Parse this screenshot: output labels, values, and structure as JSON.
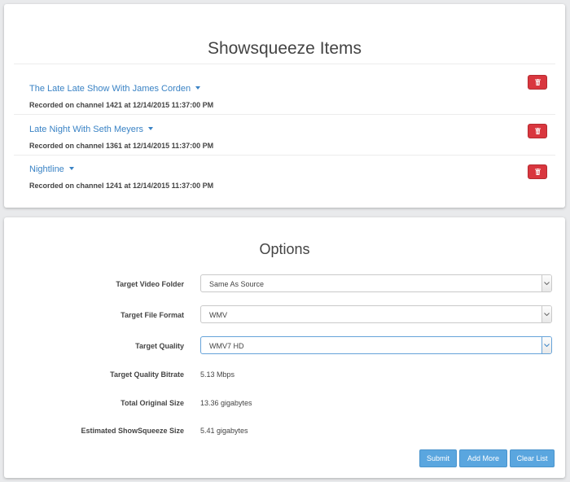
{
  "items_panel": {
    "title": "Showsqueeze Items",
    "items": [
      {
        "title": "The Late Late Show With James Corden",
        "detail": "Recorded on channel 1421 at 12/14/2015 11:37:00 PM"
      },
      {
        "title": "Late Night With Seth Meyers",
        "detail": "Recorded on channel 1361 at 12/14/2015 11:37:00 PM"
      },
      {
        "title": "Nightline",
        "detail": "Recorded on channel 1241 at 12/14/2015 11:37:00 PM"
      }
    ],
    "delete_icon": "trash-icon"
  },
  "options_panel": {
    "title": "Options",
    "target_video_folder": {
      "label": "Target Video Folder",
      "value": "Same As Source"
    },
    "target_file_format": {
      "label": "Target File Format",
      "value": "WMV"
    },
    "target_quality": {
      "label": "Target Quality",
      "value": "WMV7 HD"
    },
    "target_quality_bitrate": {
      "label": "Target Quality Bitrate",
      "value": "5.13 Mbps"
    },
    "total_original_size": {
      "label": "Total Original Size",
      "value": "13.36 gigabytes"
    },
    "estimated_size": {
      "label": "Estimated ShowSqueeze Size",
      "value": "5.41 gigabytes"
    },
    "buttons": {
      "submit": "Submit",
      "add_more": "Add More",
      "clear_list": "Clear List"
    }
  },
  "colors": {
    "link": "#3a83c5",
    "danger": "#d9363e",
    "primary": "#5aa6df",
    "background": "#e9eaec"
  }
}
